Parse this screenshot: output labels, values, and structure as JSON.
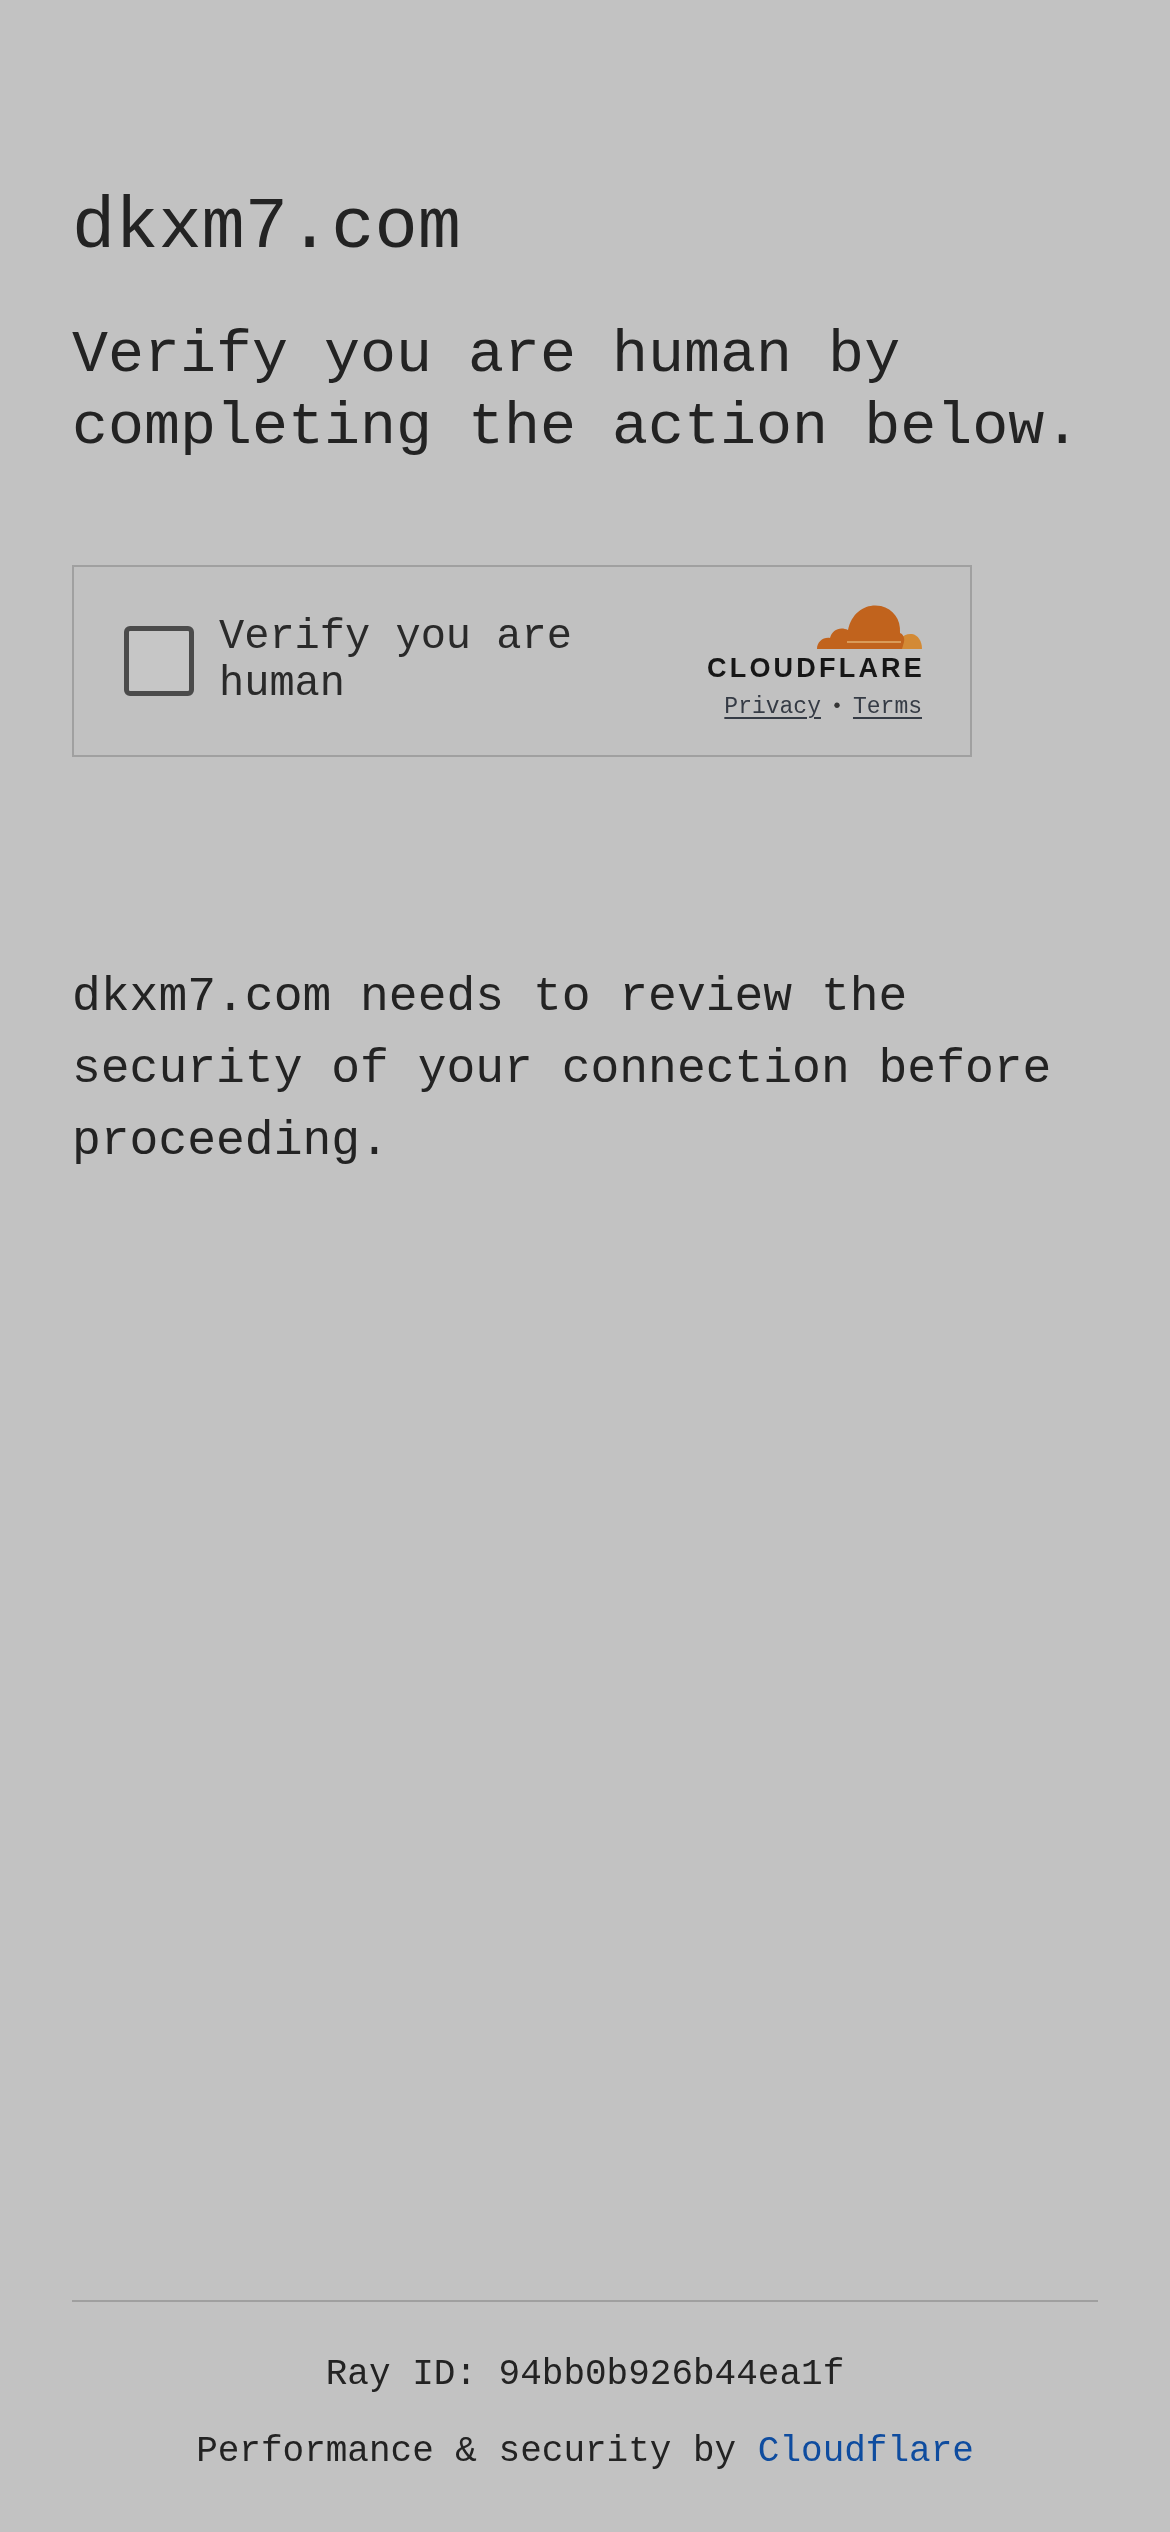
{
  "page": {
    "site_title": "dkxm7.com",
    "heading": "Verify you are human by completing the action below."
  },
  "widget": {
    "checkbox_label": "Verify you are human",
    "checked": false,
    "brand": "CLOUDFLARE",
    "links": [
      {
        "label": "Privacy"
      },
      {
        "label": "Terms"
      }
    ],
    "separator": "•"
  },
  "message": "dkxm7.com needs to review the security of your connection before proceeding.",
  "footer": {
    "ray_id": "Ray ID: 94bb0b926b44ea1f",
    "credit": "Performance & security by",
    "credit_link": "Cloudflare"
  }
}
